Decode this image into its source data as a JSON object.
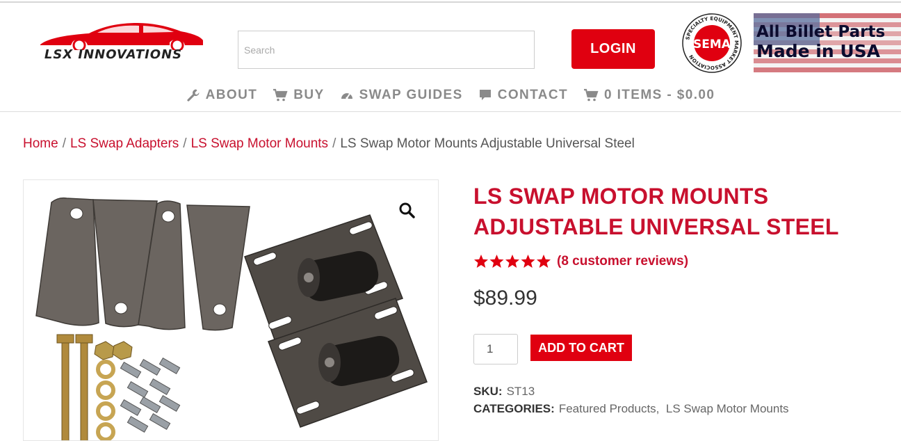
{
  "header": {
    "logo_text": "LSX INNOVATIONS",
    "search_placeholder": "Search",
    "login_label": "LOGIN",
    "sema_text": "SPECIALTY EQUIPMENT MARKET ASSOCIATION",
    "sema_abbr": "SEMA",
    "usa_banner_line1": "All Billet Parts",
    "usa_banner_line2": "Made in USA"
  },
  "nav": {
    "items": [
      {
        "label": "ABOUT",
        "icon": "wrench-icon"
      },
      {
        "label": "BUY",
        "icon": "cart-icon"
      },
      {
        "label": "SWAP GUIDES",
        "icon": "gauge-icon"
      },
      {
        "label": "CONTACT",
        "icon": "chat-icon"
      },
      {
        "label": "0 ITEMS - $0.00",
        "icon": "cart-icon"
      }
    ]
  },
  "breadcrumb": {
    "home": "Home",
    "level1": "LS Swap Adapters",
    "level2": "LS Swap Motor Mounts",
    "current": "LS Swap Motor Mounts Adjustable Universal Steel",
    "separator": "/"
  },
  "product": {
    "title": "LS SWAP MOTOR MOUNTS ADJUSTABLE UNIVERSAL STEEL",
    "rating": 5,
    "reviews_label": "(8 customer reviews)",
    "price": "$89.99",
    "quantity": "1",
    "add_to_cart_label": "ADD TO CART",
    "sku_label": "SKU:",
    "sku_value": "ST13",
    "categories_label": "CATEGORIES:",
    "categories": [
      "Featured Products",
      "LS Swap Motor Mounts"
    ],
    "category_separator": ","
  },
  "colors": {
    "brand_red": "#e00010",
    "link_red": "#c8102e",
    "nav_gray": "#8a8a8a"
  }
}
